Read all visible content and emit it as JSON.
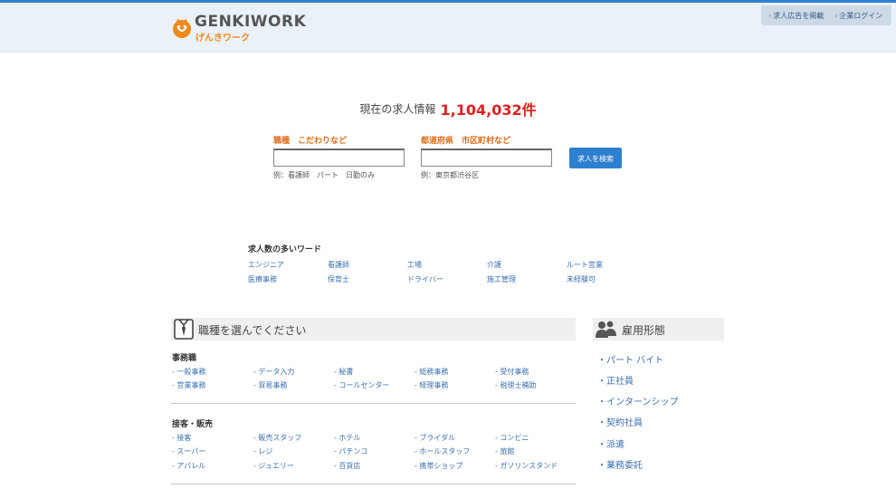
{
  "brand": {
    "name_en": "GENKIWORK",
    "name_jp": "げんきワーク"
  },
  "topnav": {
    "items": [
      "求人広告を掲載",
      "企業ログイン"
    ]
  },
  "job_count": {
    "label": "現在の求人情報",
    "value": "1,104,032件"
  },
  "search": {
    "keyword": {
      "label": "職種　こだわりなど",
      "value": "",
      "hint": "例：看護師　パート　日勤のみ"
    },
    "location": {
      "label": "都道府県　市区町村など",
      "value": "",
      "hint": "例：東京都渋谷区"
    },
    "button_label": "求人を検索"
  },
  "popular": {
    "title": "求人数の多いワード",
    "words": [
      "エンジニア",
      "看護師",
      "工場",
      "介護",
      "ルート営業",
      "医療事務",
      "保育士",
      "ドライバー",
      "施工管理",
      "未経験可"
    ]
  },
  "job_types": {
    "title": "職種を選んでください",
    "categories": [
      {
        "name": "事務職",
        "items": [
          "- 一般事務",
          "- データ入力",
          "- 秘書",
          "- 総務事務",
          "- 受付事務",
          "- 営業事務",
          "- 貿易事務",
          "- コールセンター",
          "- 経理事務",
          "- 税理士補助"
        ]
      },
      {
        "name": "接客・販売",
        "items": [
          "- 接客",
          "- 販売スタッフ",
          "- ホテル",
          "- ブライダル",
          "- コンビニ",
          "- スーパー",
          "- レジ",
          "- パチンコ",
          "- ホールスタッフ",
          "- 旅館",
          "- アパレル",
          "- ジュエリー",
          "- 百貨店",
          "- 携帯ショップ",
          "- ガソリンスタンド"
        ]
      }
    ]
  },
  "employment": {
    "title": "雇用形態",
    "items": [
      "・パート バイト",
      "・正社員",
      "・インターンシップ",
      "・契約社員",
      "・派遣",
      "・業務委託"
    ]
  },
  "colors": {
    "accent_blue": "#2f7fd0",
    "count_red": "#e02020",
    "label_orange": "#e06d17",
    "link_blue": "#3a6fb0"
  }
}
